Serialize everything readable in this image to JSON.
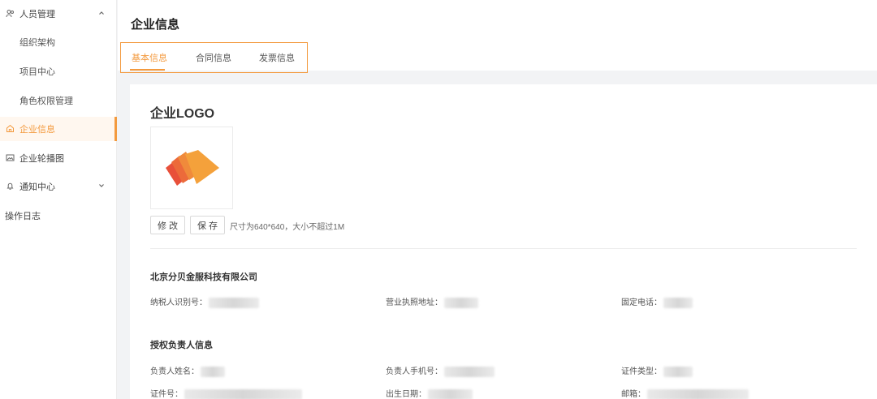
{
  "sidebar": {
    "items": [
      {
        "label": "人员管理",
        "icon": "people-icon"
      },
      {
        "label": "组织架构"
      },
      {
        "label": "项目中心"
      },
      {
        "label": "角色权限管理"
      },
      {
        "label": "企业信息",
        "icon": "home-icon"
      },
      {
        "label": "企业轮播图",
        "icon": "image-icon"
      },
      {
        "label": "通知中心",
        "icon": "bell-icon"
      },
      {
        "label": "操作日志"
      }
    ]
  },
  "header": {
    "title": "企业信息",
    "tabs": [
      {
        "label": "基本信息",
        "active": true
      },
      {
        "label": "合同信息",
        "active": false
      },
      {
        "label": "发票信息",
        "active": false
      }
    ]
  },
  "logo_section": {
    "title": "企业LOGO",
    "modify_label": "修 改",
    "save_label": "保 存",
    "hint": "尺寸为640*640，大小不超过1M"
  },
  "company": {
    "name": "北京分贝金服科技有限公司",
    "fields": [
      {
        "label": "纳税人识别号："
      },
      {
        "label": "营业执照地址："
      },
      {
        "label": "固定电话："
      }
    ]
  },
  "authorized": {
    "title": "授权负责人信息",
    "fields": [
      {
        "label": "负责人姓名："
      },
      {
        "label": "负责人手机号："
      },
      {
        "label": "证件类型："
      },
      {
        "label": "证件号："
      },
      {
        "label": "出生日期："
      },
      {
        "label": "邮箱："
      }
    ]
  },
  "colors": {
    "accent": "#f39a3e",
    "logo_orange": "#f4a13b",
    "logo_red": "#e8503a"
  }
}
